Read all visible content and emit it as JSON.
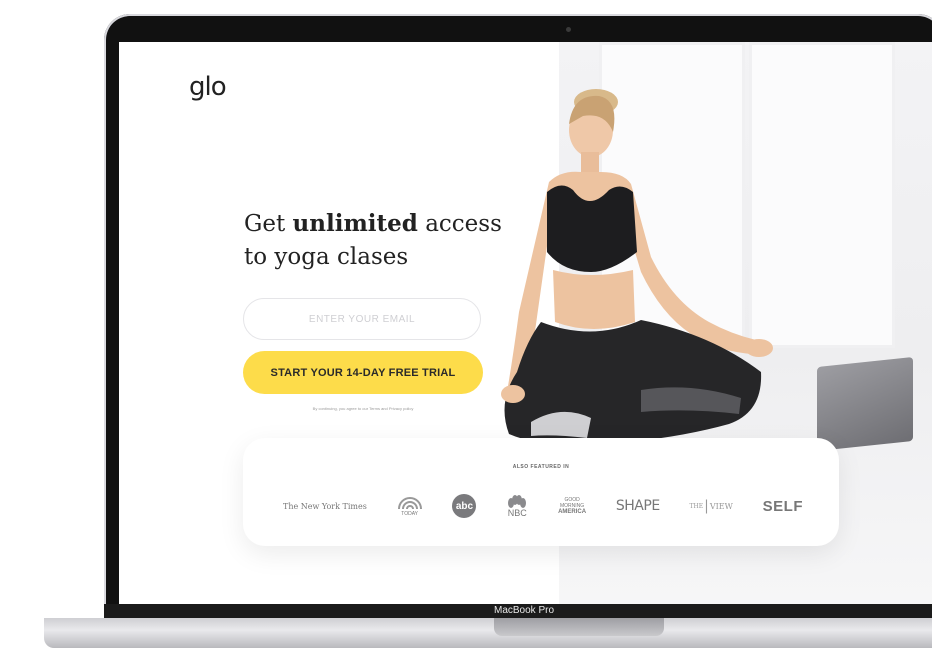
{
  "device": {
    "bezel_label": "MacBook Pro"
  },
  "page": {
    "logo": "glo",
    "headline": {
      "line1_prefix": "Get ",
      "line1_bold": "unlimited",
      "line1_suffix": " access",
      "line2": "to yoga clases"
    },
    "email_placeholder": "ENTER YOUR EMAIL",
    "cta_label": "START YOUR 14-DAY FREE TRIAL",
    "disclaimer": "By continuing, you agree to our Terms and Privacy policy"
  },
  "featured": {
    "label": "ALSO FEATURED IN",
    "logos": {
      "nyt": "The New York Times",
      "today": "TODAY",
      "abc": "abc",
      "nbc": "NBC",
      "gma_line1": "GOOD",
      "gma_line2": "MORNING",
      "gma_line3": "AMERICA",
      "shape": "SHAPE",
      "view_the": "THE",
      "view_view": "VIEW",
      "self": "SELF"
    }
  },
  "colors": {
    "accent": "#fddc4a",
    "text": "#222222"
  }
}
